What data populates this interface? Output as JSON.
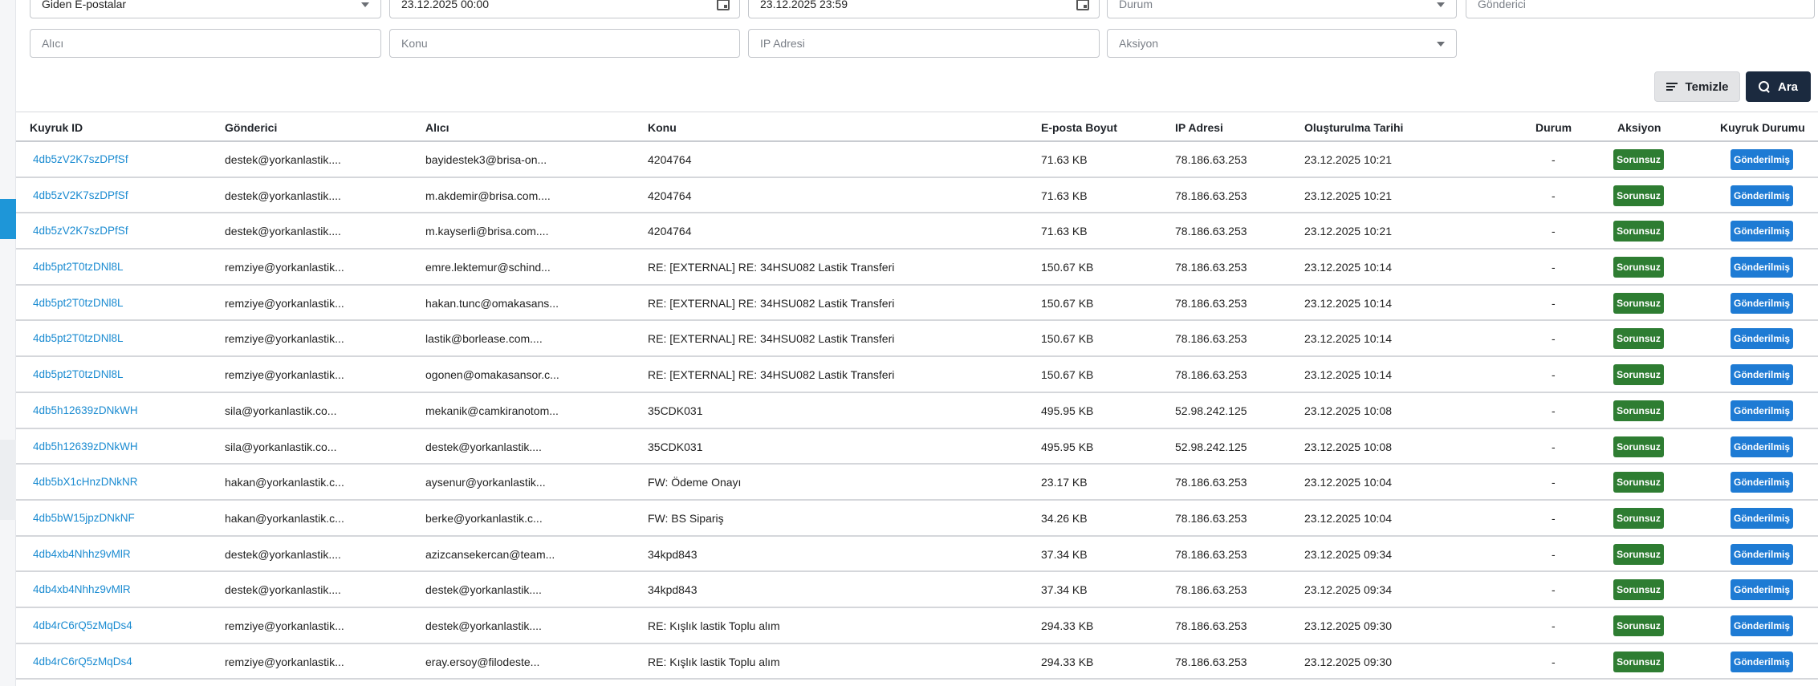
{
  "filters": {
    "mail_type": "Giden E-postalar",
    "start_date": "23.12.2025 00:00",
    "end_date": "23.12.2025 23:59",
    "status_placeholder": "Durum",
    "sender_placeholder": "Gönderici",
    "recipient_placeholder": "Alıcı",
    "subject_placeholder": "Konu",
    "ip_placeholder": "IP Adresi",
    "action_placeholder": "Aksiyon"
  },
  "buttons": {
    "clear": "Temizle",
    "search": "Ara"
  },
  "columns": {
    "queue_id": "Kuyruk ID",
    "sender": "Gönderici",
    "recipient": "Alıcı",
    "subject": "Konu",
    "size": "E-posta Boyut",
    "ip": "IP Adresi",
    "created": "Oluşturulma Tarihi",
    "status": "Durum",
    "action": "Aksiyon",
    "queue_status": "Kuyruk Durumu"
  },
  "colors": {
    "link": "#1a8bd1",
    "action_badge": "#2e7d32",
    "queue_badge": "#1e7bd4",
    "search_button": "#1b2a3f"
  },
  "rows": [
    {
      "id": "4db5zV2K7szDPfSf",
      "sender": "destek@yorkanlastik....",
      "recipient": "bayidestek3@brisa-on...",
      "subject": "4204764",
      "size": "71.63 KB",
      "ip": "78.186.63.253",
      "created": "23.12.2025 10:21",
      "status": "-",
      "action": "Sorunsuz",
      "queue": "Gönderilmiş"
    },
    {
      "id": "4db5zV2K7szDPfSf",
      "sender": "destek@yorkanlastik....",
      "recipient": "m.akdemir@brisa.com....",
      "subject": "4204764",
      "size": "71.63 KB",
      "ip": "78.186.63.253",
      "created": "23.12.2025 10:21",
      "status": "-",
      "action": "Sorunsuz",
      "queue": "Gönderilmiş"
    },
    {
      "id": "4db5zV2K7szDPfSf",
      "sender": "destek@yorkanlastik....",
      "recipient": "m.kayserli@brisa.com....",
      "subject": "4204764",
      "size": "71.63 KB",
      "ip": "78.186.63.253",
      "created": "23.12.2025 10:21",
      "status": "-",
      "action": "Sorunsuz",
      "queue": "Gönderilmiş"
    },
    {
      "id": "4db5pt2T0tzDNl8L",
      "sender": "remziye@yorkanlastik...",
      "recipient": "emre.lektemur@schind...",
      "subject": "RE: [EXTERNAL] RE: 34HSU082 Lastik Transferi",
      "size": "150.67 KB",
      "ip": "78.186.63.253",
      "created": "23.12.2025 10:14",
      "status": "-",
      "action": "Sorunsuz",
      "queue": "Gönderilmiş"
    },
    {
      "id": "4db5pt2T0tzDNl8L",
      "sender": "remziye@yorkanlastik...",
      "recipient": "hakan.tunc@omakasans...",
      "subject": "RE: [EXTERNAL] RE: 34HSU082 Lastik Transferi",
      "size": "150.67 KB",
      "ip": "78.186.63.253",
      "created": "23.12.2025 10:14",
      "status": "-",
      "action": "Sorunsuz",
      "queue": "Gönderilmiş"
    },
    {
      "id": "4db5pt2T0tzDNl8L",
      "sender": "remziye@yorkanlastik...",
      "recipient": "lastik@borlease.com....",
      "subject": "RE: [EXTERNAL] RE: 34HSU082 Lastik Transferi",
      "size": "150.67 KB",
      "ip": "78.186.63.253",
      "created": "23.12.2025 10:14",
      "status": "-",
      "action": "Sorunsuz",
      "queue": "Gönderilmiş"
    },
    {
      "id": "4db5pt2T0tzDNl8L",
      "sender": "remziye@yorkanlastik...",
      "recipient": "ogonen@omakasansor.c...",
      "subject": "RE: [EXTERNAL] RE: 34HSU082 Lastik Transferi",
      "size": "150.67 KB",
      "ip": "78.186.63.253",
      "created": "23.12.2025 10:14",
      "status": "-",
      "action": "Sorunsuz",
      "queue": "Gönderilmiş"
    },
    {
      "id": "4db5h12639zDNkWH",
      "sender": "sila@yorkanlastik.co...",
      "recipient": "mekanik@camkiranotom...",
      "subject": "35CDK031",
      "size": "495.95 KB",
      "ip": "52.98.242.125",
      "created": "23.12.2025 10:08",
      "status": "-",
      "action": "Sorunsuz",
      "queue": "Gönderilmiş"
    },
    {
      "id": "4db5h12639zDNkWH",
      "sender": "sila@yorkanlastik.co...",
      "recipient": "destek@yorkanlastik....",
      "subject": "35CDK031",
      "size": "495.95 KB",
      "ip": "52.98.242.125",
      "created": "23.12.2025 10:08",
      "status": "-",
      "action": "Sorunsuz",
      "queue": "Gönderilmiş"
    },
    {
      "id": "4db5bX1cHnzDNkNR",
      "sender": "hakan@yorkanlastik.c...",
      "recipient": "aysenur@yorkanlastik...",
      "subject": "FW: Ödeme Onayı",
      "size": "23.17 KB",
      "ip": "78.186.63.253",
      "created": "23.12.2025 10:04",
      "status": "-",
      "action": "Sorunsuz",
      "queue": "Gönderilmiş"
    },
    {
      "id": "4db5bW15jpzDNkNF",
      "sender": "hakan@yorkanlastik.c...",
      "recipient": "berke@yorkanlastik.c...",
      "subject": "FW: BS Sipariş",
      "size": "34.26 KB",
      "ip": "78.186.63.253",
      "created": "23.12.2025 10:04",
      "status": "-",
      "action": "Sorunsuz",
      "queue": "Gönderilmiş"
    },
    {
      "id": "4db4xb4Nhhz9vMlR",
      "sender": "destek@yorkanlastik....",
      "recipient": "azizcansekercan@team...",
      "subject": "34kpd843",
      "size": "37.34 KB",
      "ip": "78.186.63.253",
      "created": "23.12.2025 09:34",
      "status": "-",
      "action": "Sorunsuz",
      "queue": "Gönderilmiş"
    },
    {
      "id": "4db4xb4Nhhz9vMlR",
      "sender": "destek@yorkanlastik....",
      "recipient": "destek@yorkanlastik....",
      "subject": "34kpd843",
      "size": "37.34 KB",
      "ip": "78.186.63.253",
      "created": "23.12.2025 09:34",
      "status": "-",
      "action": "Sorunsuz",
      "queue": "Gönderilmiş"
    },
    {
      "id": "4db4rC6rQ5zMqDs4",
      "sender": "remziye@yorkanlastik...",
      "recipient": "destek@yorkanlastik....",
      "subject": "RE: Kışlık lastik Toplu alım",
      "size": "294.33 KB",
      "ip": "78.186.63.253",
      "created": "23.12.2025 09:30",
      "status": "-",
      "action": "Sorunsuz",
      "queue": "Gönderilmiş"
    },
    {
      "id": "4db4rC6rQ5zMqDs4",
      "sender": "remziye@yorkanlastik...",
      "recipient": "eray.ersoy@filodeste...",
      "subject": "RE: Kışlık lastik Toplu alım",
      "size": "294.33 KB",
      "ip": "78.186.63.253",
      "created": "23.12.2025 09:30",
      "status": "-",
      "action": "Sorunsuz",
      "queue": "Gönderilmiş"
    }
  ]
}
